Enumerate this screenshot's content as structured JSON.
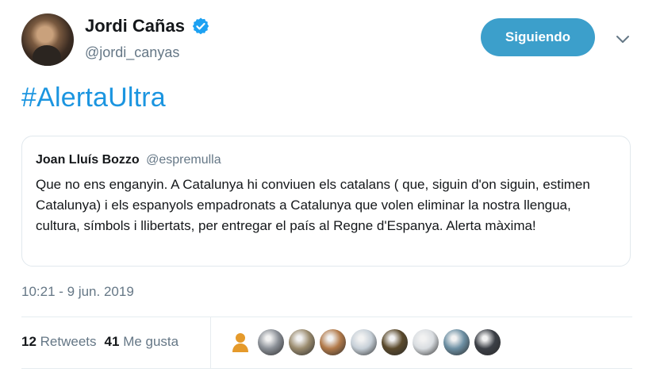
{
  "header": {
    "display_name": "Jordi Cañas",
    "handle": "@jordi_canyas",
    "follow_label": "Siguiendo"
  },
  "tweet": {
    "text": "#AlertaUltra"
  },
  "quoted": {
    "name": "Joan Lluís Bozzo",
    "handle": "@espremulla",
    "body": "Que no ens enganyin. A Catalunya hi conviuen els catalans ( que, siguin d'on siguin, estimen Catalunya) i els espanyols empadronats a Catalunya que volen eliminar la nostra llengua, cultura, símbols i llibertats, per entregar el país al Regne d'Espanya. Alerta màxima!"
  },
  "timestamp": "10:21 - 9 jun. 2019",
  "stats": {
    "retweets_count": "12",
    "retweets_label": "Retweets",
    "likes_count": "41",
    "likes_label": "Me gusta"
  },
  "colors": {
    "accent": "#1b95e0",
    "button": "#3c9fcb",
    "muted": "#657786",
    "border": "#e1e8ed"
  },
  "icons": {
    "verified": "verified-badge-icon",
    "caret": "chevron-down-icon",
    "default_profile": "egg-avatar-icon"
  },
  "liker_avatars": [
    {
      "tone": "#e59a2b"
    },
    {
      "tone": "#8a8f96"
    },
    {
      "tone": "#9a8b6e"
    },
    {
      "tone": "#b27a4a"
    },
    {
      "tone": "#c7d0d8"
    },
    {
      "tone": "#5b4a2c"
    },
    {
      "tone": "#d9dde1"
    },
    {
      "tone": "#6c8fa3"
    },
    {
      "tone": "#3b3f46"
    }
  ]
}
